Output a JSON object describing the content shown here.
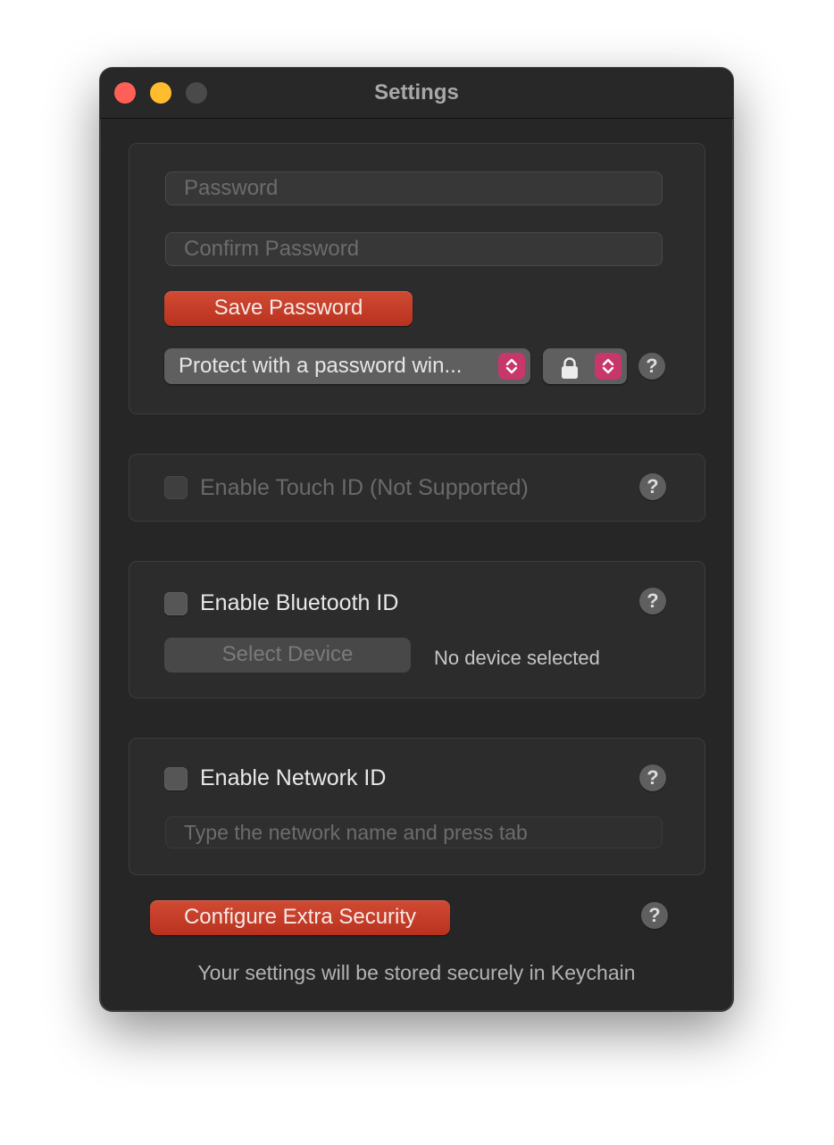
{
  "window": {
    "title": "Settings",
    "traffic_lights": [
      {
        "name": "close",
        "color": "#fe5f57"
      },
      {
        "name": "minimize",
        "color": "#febc2e"
      },
      {
        "name": "zoom",
        "color": "#4a4a4a"
      }
    ]
  },
  "password_section": {
    "password_placeholder": "Password",
    "password_value": "",
    "confirm_placeholder": "Confirm Password",
    "confirm_value": "",
    "save_button": "Save Password",
    "protect_popup_selected": "Protect with a password win...",
    "lock_popup_icon": "lock-icon",
    "help": "?"
  },
  "touch_id": {
    "label": "Enable Touch ID (Not Supported)",
    "checked": false,
    "disabled": true,
    "help": "?"
  },
  "bluetooth_id": {
    "label": "Enable Bluetooth ID",
    "checked": false,
    "select_device_button": "Select Device",
    "status": "No device selected",
    "help": "?"
  },
  "network_id": {
    "label": "Enable Network ID",
    "checked": false,
    "network_placeholder": "Type the network name and press tab",
    "network_value": "",
    "help": "?"
  },
  "footer": {
    "extra_security_button": "Configure Extra Security",
    "help": "?",
    "keychain_note": "Your settings will be stored securely in Keychain"
  },
  "colors": {
    "accent_red": "#c13e28",
    "stepper_pink": "#c7376a",
    "window_bg": "#262626"
  }
}
